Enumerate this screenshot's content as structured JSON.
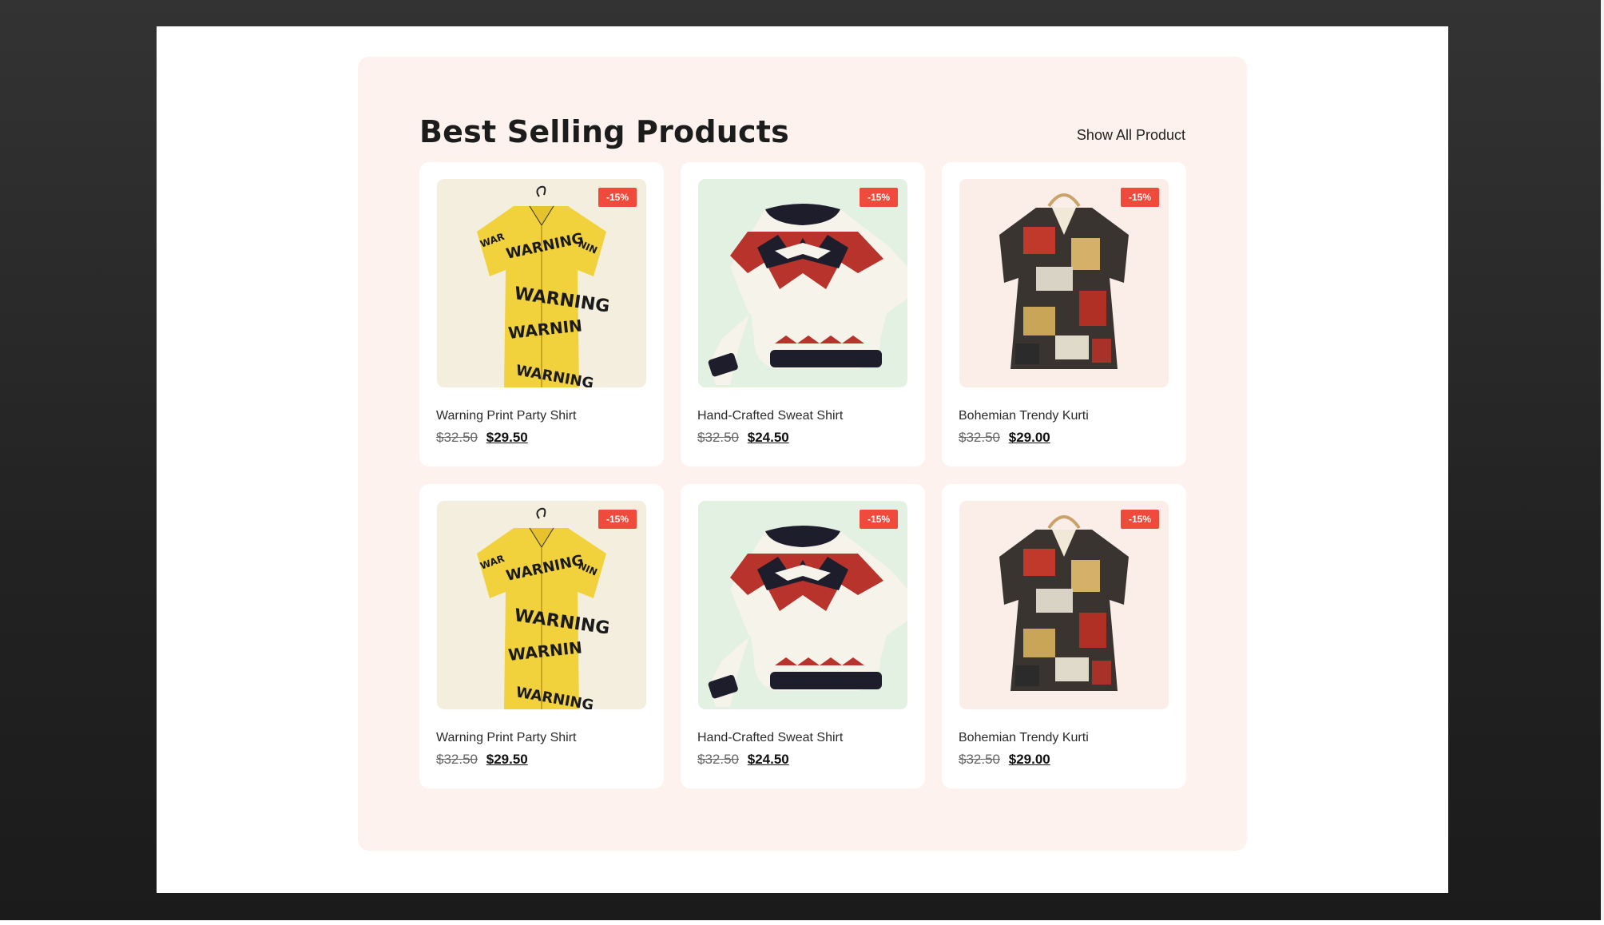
{
  "section": {
    "title": "Best Selling Products",
    "show_all_label": "Show All Product"
  },
  "products": [
    {
      "name": "Warning Print Party Shirt",
      "old_price": "$32.50",
      "new_price": "$29.50",
      "badge": "-15%",
      "icon": "yellow-warning-shirt"
    },
    {
      "name": "Hand-Crafted Sweat Shirt",
      "old_price": "$32.50",
      "new_price": "$24.50",
      "badge": "-15%",
      "icon": "fair-isle-sweater"
    },
    {
      "name": "Bohemian Trendy Kurti",
      "old_price": "$32.50",
      "new_price": "$29.00",
      "badge": "-15%",
      "icon": "patterned-kurti"
    },
    {
      "name": "Warning Print Party Shirt",
      "old_price": "$32.50",
      "new_price": "$29.50",
      "badge": "-15%",
      "icon": "yellow-warning-shirt"
    },
    {
      "name": "Hand-Crafted Sweat Shirt",
      "old_price": "$32.50",
      "new_price": "$24.50",
      "badge": "-15%",
      "icon": "fair-isle-sweater"
    },
    {
      "name": "Bohemian Trendy Kurti",
      "old_price": "$32.50",
      "new_price": "$29.00",
      "badge": "-15%",
      "icon": "patterned-kurti"
    }
  ],
  "colors": {
    "section_bg": "#fdf2ed",
    "badge": "#ef4a3b",
    "thumb_shirt_bg": "#f4eedf",
    "thumb_sweater_bg": "#e3f1e2",
    "thumb_kurti_bg": "#fbeee8"
  }
}
